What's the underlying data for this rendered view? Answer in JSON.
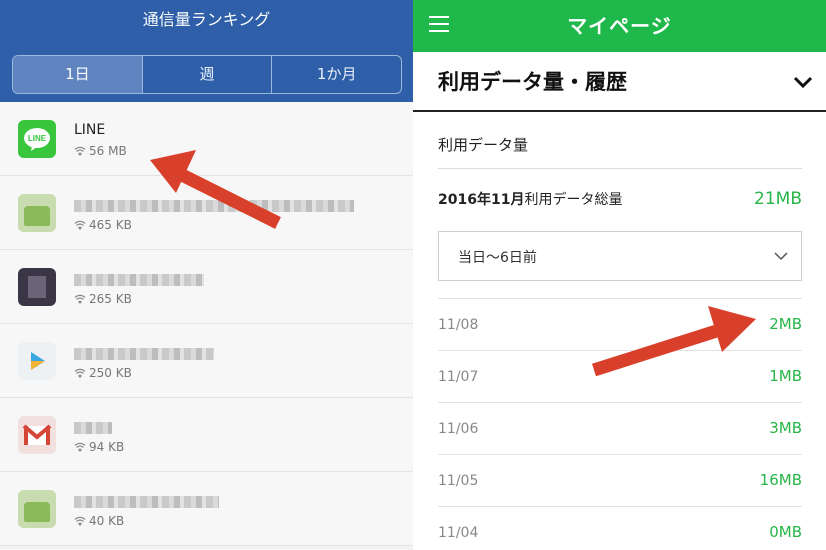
{
  "left": {
    "title": "通信量ランキング",
    "tabs": [
      {
        "label": "1日",
        "active": true
      },
      {
        "label": "週",
        "active": false
      },
      {
        "label": "1か月",
        "active": false
      }
    ],
    "apps": [
      {
        "name": "LINE",
        "size": "56 MB",
        "icon": "line-app-icon"
      },
      {
        "name": "",
        "size": "465 KB",
        "icon": "android-app-icon"
      },
      {
        "name": "",
        "size": "265 KB",
        "icon": "dark-app-icon"
      },
      {
        "name": "",
        "size": "250 KB",
        "icon": "play-store-icon"
      },
      {
        "name": "",
        "size": "94 KB",
        "icon": "gmail-icon"
      },
      {
        "name": "",
        "size": "40 KB",
        "icon": "android-app-icon"
      }
    ]
  },
  "right": {
    "header_title": "マイページ",
    "section_title": "利用データ量・履歴",
    "sub_title": "利用データ量",
    "total_label_bold": "2016年11月",
    "total_label_rest": "利用データ総量",
    "total_value": "21MB",
    "select_value": "当日〜6日前",
    "rows": [
      {
        "date": "11/08",
        "value": "2MB"
      },
      {
        "date": "11/07",
        "value": "1MB"
      },
      {
        "date": "11/06",
        "value": "3MB"
      },
      {
        "date": "11/05",
        "value": "16MB"
      },
      {
        "date": "11/04",
        "value": "0MB"
      }
    ]
  },
  "colors": {
    "left_header": "#2e5fa8",
    "right_header": "#1fb84a",
    "value_green": "#27b547",
    "arrow_red": "#d9402b"
  }
}
